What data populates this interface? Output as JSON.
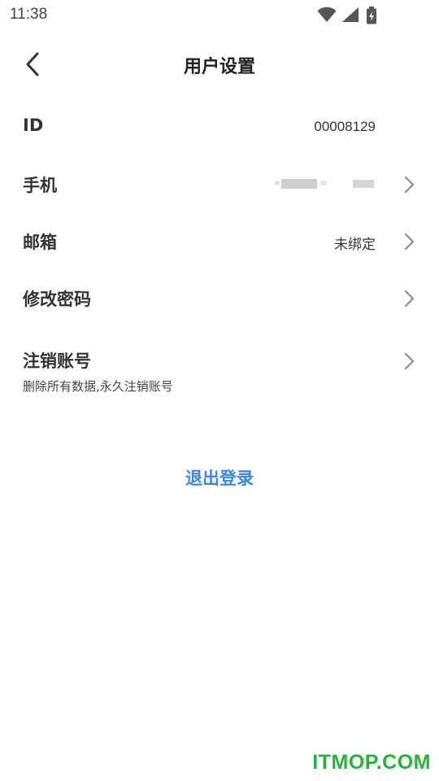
{
  "status_bar": {
    "time": "11:38",
    "icons": [
      "wifi-icon",
      "signal-icon",
      "battery-charging-icon"
    ]
  },
  "header": {
    "title": "用户设置",
    "back_icon": "chevron-left-icon"
  },
  "settings": {
    "id_label": "ID",
    "id_value": "00008129",
    "phone_label": "手机",
    "email_label": "邮箱",
    "email_value": "未绑定",
    "password_label": "修改密码",
    "delete_label": "注销账号",
    "delete_desc": "删除所有数据,永久注销账号"
  },
  "logout_label": "退出登录",
  "watermark": "ITMOP.COM",
  "colors": {
    "accent": "#3d86e8",
    "watermark": "#26b33a",
    "text": "#333333",
    "chevron": "#888888"
  }
}
